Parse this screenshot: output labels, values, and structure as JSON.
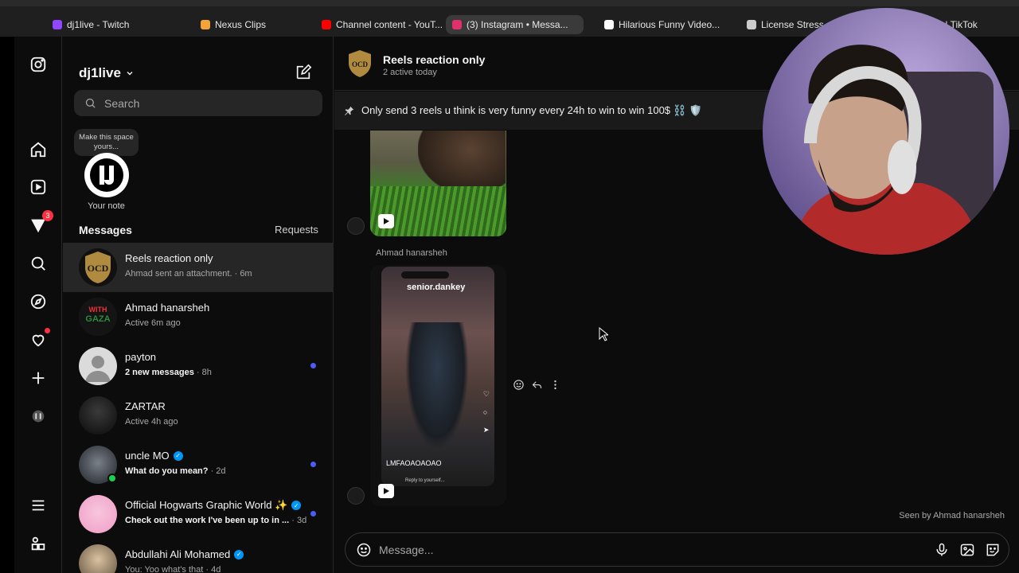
{
  "browser": {
    "tabs": [
      {
        "label": "dj1live - Twitch",
        "color": "#9146ff"
      },
      {
        "label": "Nexus Clips",
        "color": "#f2a33a"
      },
      {
        "label": "Channel content - YouT...",
        "color": "#ff0000"
      },
      {
        "label": "(3) Instagram • Messa...",
        "color": "#e1306c",
        "active": true
      },
      {
        "label": "Hilarious Funny Video...",
        "color": "#ffffff"
      },
      {
        "label": "License Stress...",
        "color": "#cccccc"
      },
      {
        "label": "...s | TikTok",
        "color": "#ffffff"
      }
    ]
  },
  "rail": {
    "notifications_badge": "3"
  },
  "inbox": {
    "account_name": "dj1live",
    "search_placeholder": "Search",
    "note_bubble": "Make this space yours...",
    "note_label": "Your note",
    "messages_heading": "Messages",
    "requests_label": "Requests",
    "conversations": [
      {
        "name": "Reels reaction only",
        "preview": "Ahmad sent an attachment.",
        "time": "6m",
        "selected": true
      },
      {
        "name": "Ahmad hanarsheh",
        "preview": "Active 6m ago",
        "time": ""
      },
      {
        "name": "payton",
        "preview": "2 new messages",
        "time": "8h",
        "unread": true
      },
      {
        "name": "ZARTAR",
        "preview": "Active 4h ago",
        "time": ""
      },
      {
        "name": "uncle MO",
        "preview": "What do you mean?",
        "time": "2d",
        "unread": true,
        "verified": true
      },
      {
        "name": "Official Hogwarts Graphic World ✨",
        "preview": "Check out the work I've been up to in ...",
        "time": "3d",
        "unread": true,
        "verified": true
      },
      {
        "name": "Abdullahi Ali Mohamed",
        "preview": "You: Yoo what's that",
        "time": "4d",
        "verified": true
      }
    ]
  },
  "chat": {
    "title": "Reels reaction only",
    "subtitle": "2 active today",
    "pinned_message": "Only send 3 reels u think is very funny every 24h to win to win 100$ ⛓️ 🛡️",
    "sender_name": "Ahmad hanarsheh",
    "reel_username": "senior.dankey",
    "reel_caption": "LMFAOAOAOAO",
    "reel_reply_hint": "Reply to yourself...",
    "seen_by": "Seen by Ahmad hanarsheh",
    "composer_placeholder": "Message..."
  }
}
